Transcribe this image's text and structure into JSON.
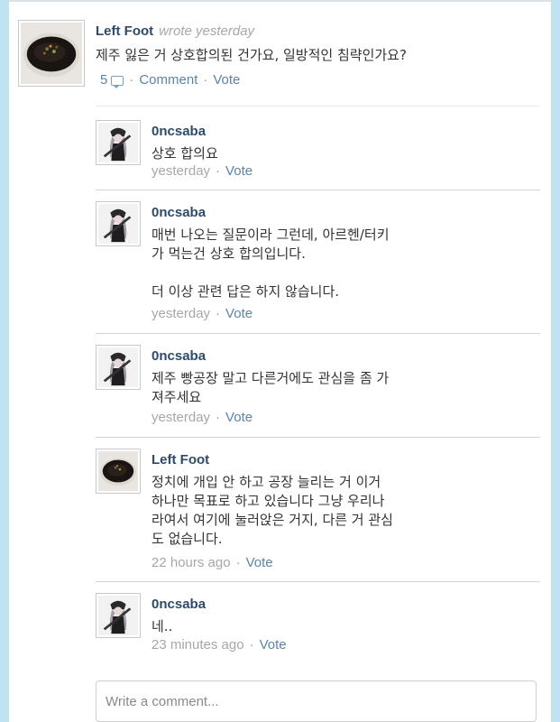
{
  "post": {
    "author": "Left Foot",
    "wrote": "wrote yesterday",
    "text": "제주 잃은 거 상호합의된 건가요, 일방적인 침략인가요?",
    "comment_count": "5",
    "comment_label": "Comment",
    "vote_label": "Vote"
  },
  "comments": [
    {
      "author": "0ncsaba",
      "text": "상호 합의요",
      "time": "yesterday",
      "vote": "Vote"
    },
    {
      "author": "0ncsaba",
      "text": "매번 나오는 질문이라 그런데, 아르헨/터키\n가 먹는건 상호 합의입니다.\n\n더 이상 관련 답은 하지 않습니다.",
      "time": "yesterday",
      "vote": "Vote"
    },
    {
      "author": "0ncsaba",
      "text": "제주 빵공장 말고 다른거에도 관심을 좀 가\n져주세요",
      "time": "yesterday",
      "vote": "Vote"
    },
    {
      "author": "Left Foot",
      "text": "정치에 개입 안 하고 공장 늘리는 거 이거\n하나만 목표로 하고 있습니다 그냥 우리나\n라여서 여기에 눌러앉은 거지, 다른 거 관심\n도 없습니다.",
      "time": "22 hours ago",
      "vote": "Vote"
    },
    {
      "author": "0ncsaba",
      "text": "네..",
      "time": "23 minutes ago",
      "vote": "Vote"
    }
  ],
  "input": {
    "placeholder": "Write a comment..."
  }
}
